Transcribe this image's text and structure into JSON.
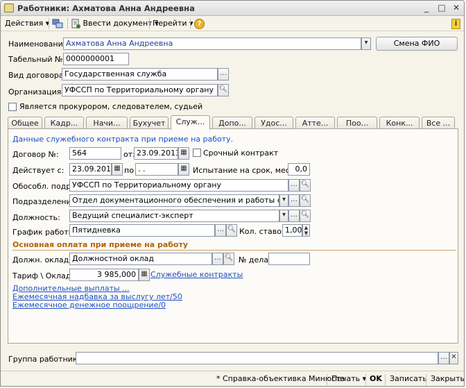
{
  "window": {
    "title": "Работники: Ахматова Анна Андреевна"
  },
  "toolbar": {
    "actions": "Действия",
    "enter_doc": "Ввести документ",
    "goto": "Перейти",
    "help": "?"
  },
  "top": {
    "name_label": "Наименование:",
    "name_value": "Ахматова Анна Андреевна",
    "change_fio": "Смена ФИО",
    "tab_no_label": "Табельный №:",
    "tab_no_value": "0000000001",
    "contract_type_label": "Вид договора:",
    "contract_type_value": "Государственная служба",
    "org_label": "Организация:",
    "org_value": "УФССП по Территориальному органу",
    "prosecutor_label": "Является прокурором, следователем, судьей"
  },
  "tabs": [
    "Общее",
    "Кадр...",
    "Начи...",
    "Бухучет",
    "Служ...",
    "Допо...",
    "Удос...",
    "Атте...",
    "Поо...",
    "Конк...",
    "Все ..."
  ],
  "panel": {
    "header": "Данные служебного контракта при приеме на работу.",
    "contract_no_label": "Договор №:",
    "contract_no": "564",
    "from_label": "от:",
    "from_date": "23.09.2013",
    "fixed_term_label": "Срочный контракт",
    "valid_label": "Действует с:",
    "valid_from": "23.09.2013",
    "to_label": "по",
    "valid_to": " .  .",
    "probation_label": "Испытание на срок, мес.:",
    "probation": "0,0",
    "division_label": "Обособл. подр.:",
    "division": "УФССП по Территориальному органу",
    "dept_label": "Подразделение:",
    "dept": "Отдел документационного обеспечения и работы с обращени",
    "position_label": "Должность:",
    "position": "Ведущий специалист-эксперт",
    "schedule_label": "График работы:",
    "schedule": "Пятидневка",
    "rates_label": "Кол. ставок:",
    "rates": "1,00",
    "pay_section": "Основная оплата при приеме на работу",
    "salary_label": "Должн. оклад:",
    "salary": "Должностной оклад",
    "case_label": "№ дела:",
    "case_no": "",
    "tariff_label": "Тариф \\ Оклад:",
    "tariff": "3 985,000",
    "contracts_link": "Служебные контракты",
    "link1": "Дополнительные выплаты ...",
    "link2": "Ежемесячная надбавка за выслугу лет/50",
    "link3": "Ежемесячное денежное поощрение/0"
  },
  "group": {
    "label": "Группа работника:",
    "value": ""
  },
  "bottom": {
    "report": "Справка-объективка Минюста",
    "print": "Печать",
    "ok": "OK",
    "save": "Записать",
    "close": "Закрыть"
  }
}
